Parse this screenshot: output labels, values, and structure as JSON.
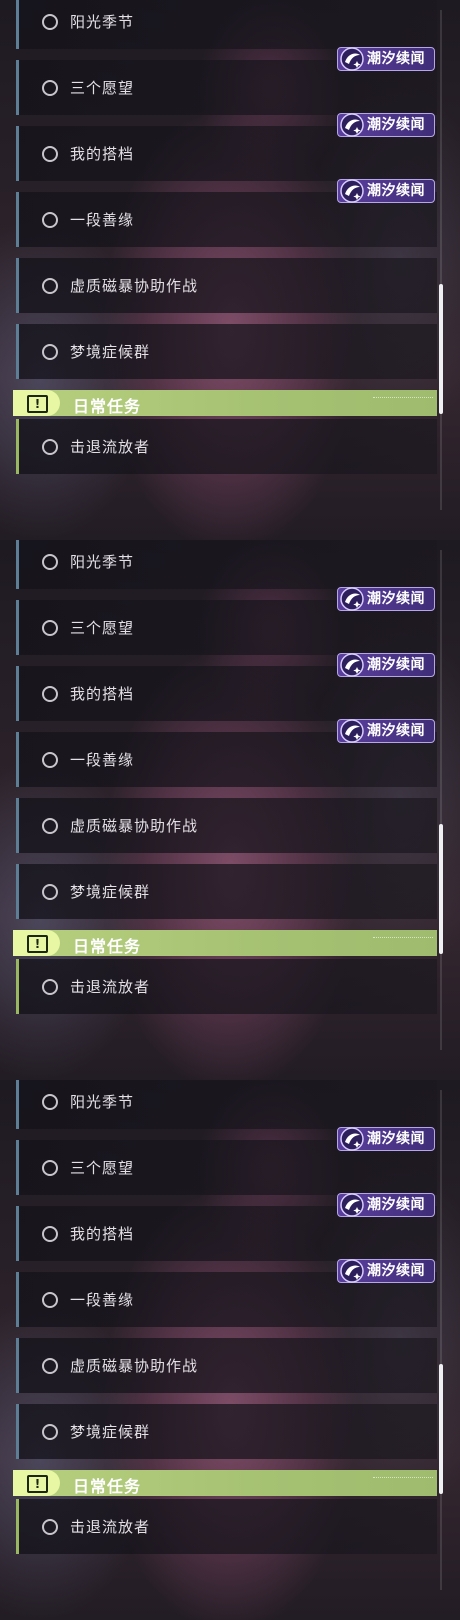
{
  "panels": [
    {
      "quests": [
        {
          "label": "阳光季节",
          "tag": null
        },
        {
          "label": "三个愿望",
          "tag": "潮汐续闻"
        },
        {
          "label": "我的搭档",
          "tag": "潮汐续闻"
        },
        {
          "label": "一段善缘",
          "tag": "潮汐续闻"
        },
        {
          "label": "虚质磁暴协助作战",
          "tag": null
        },
        {
          "label": "梦境症候群",
          "tag": null
        }
      ],
      "section": {
        "title": "日常任务",
        "icon": "exclamation-icon"
      },
      "daily_quests": [
        {
          "label": "击退流放者"
        }
      ]
    },
    {
      "quests": [
        {
          "label": "阳光季节",
          "tag": null
        },
        {
          "label": "三个愿望",
          "tag": "潮汐续闻"
        },
        {
          "label": "我的搭档",
          "tag": "潮汐续闻"
        },
        {
          "label": "一段善缘",
          "tag": "潮汐续闻"
        },
        {
          "label": "虚质磁暴协助作战",
          "tag": null
        },
        {
          "label": "梦境症候群",
          "tag": null
        }
      ],
      "section": {
        "title": "日常任务",
        "icon": "exclamation-icon"
      },
      "daily_quests": [
        {
          "label": "击退流放者"
        }
      ]
    },
    {
      "quests": [
        {
          "label": "阳光季节",
          "tag": null
        },
        {
          "label": "三个愿望",
          "tag": "潮汐续闻"
        },
        {
          "label": "我的搭档",
          "tag": "潮汐续闻"
        },
        {
          "label": "一段善缘",
          "tag": "潮汐续闻"
        },
        {
          "label": "虚质磁暴协助作战",
          "tag": null
        },
        {
          "label": "梦境症候群",
          "tag": null
        }
      ],
      "section": {
        "title": "日常任务",
        "icon": "exclamation-icon"
      },
      "daily_quests": [
        {
          "label": "击退流放者"
        }
      ]
    }
  ],
  "colors": {
    "quest_accent": "#5d7f95",
    "daily_accent": "#9ab862",
    "tag_bg": "#5b3f9e",
    "section_bg": "#b7d07f"
  },
  "scroll_position": 0.74
}
